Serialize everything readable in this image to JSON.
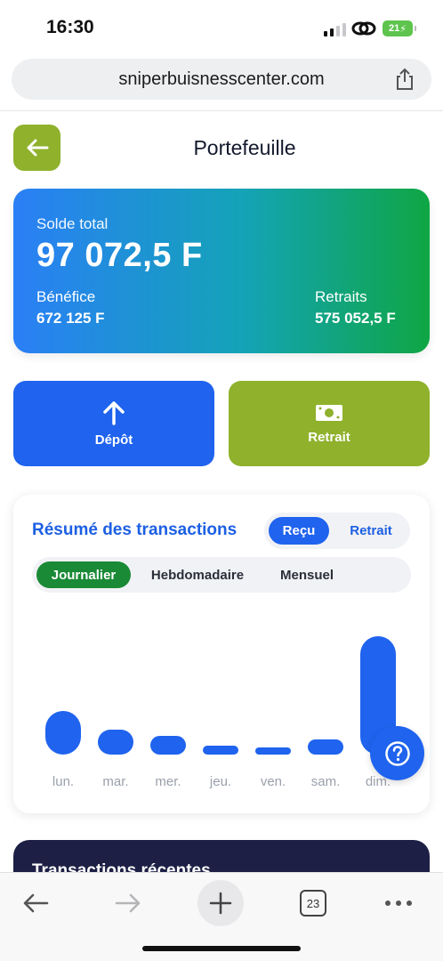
{
  "status": {
    "time": "16:30",
    "battery": "21"
  },
  "browser": {
    "url": "sniperbuisnesscenter.com",
    "tabs_count": "23"
  },
  "header": {
    "title": "Portefeuille"
  },
  "balance": {
    "label": "Solde total",
    "value": "97 072,5 F",
    "profit_label": "Bénéfice",
    "profit_value": "672 125 F",
    "withdrawals_label": "Retraits",
    "withdrawals_value": "575 052,5 F"
  },
  "actions": {
    "deposit_label": "Dépôt",
    "withdraw_label": "Retrait"
  },
  "summary": {
    "title": "Résumé des transactions",
    "type_options": [
      "Reçu",
      "Retrait"
    ],
    "period_tabs": [
      "Journalier",
      "Hebdomadaire",
      "Mensuel"
    ]
  },
  "chart_data": {
    "type": "bar",
    "categories": [
      "lun.",
      "mar.",
      "mer.",
      "jeu.",
      "ven.",
      "sam.",
      "dim."
    ],
    "values": [
      14,
      8,
      6,
      3,
      1,
      5,
      38
    ],
    "ylim": [
      0,
      40
    ],
    "grid": false
  },
  "recent": {
    "title": "Transactions récentes"
  },
  "colors": {
    "primary": "#1f63ee",
    "accent": "#8fb12c",
    "active_tab": "#1a8a36"
  }
}
